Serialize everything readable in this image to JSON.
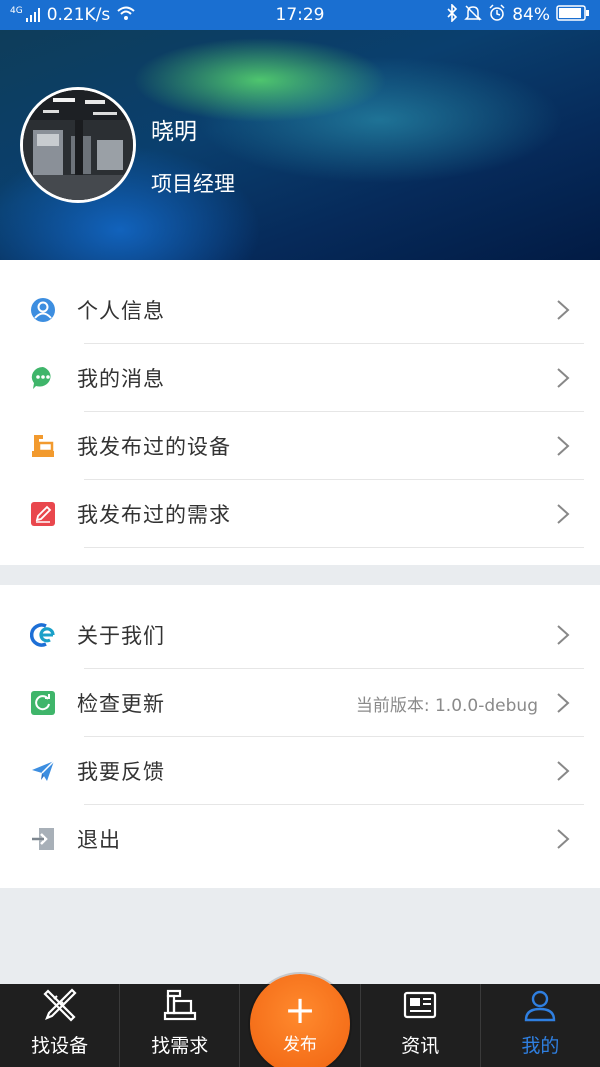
{
  "status_bar": {
    "network": "4G",
    "speed": "0.21K/s",
    "time": "17:29",
    "battery": "84%"
  },
  "profile": {
    "name": "晓明",
    "title": "项目经理"
  },
  "menu_group_1": [
    {
      "label": "个人信息",
      "icon": "person-icon"
    },
    {
      "label": "我的消息",
      "icon": "message-icon"
    },
    {
      "label": "我发布过的设备",
      "icon": "equipment-icon"
    },
    {
      "label": "我发布过的需求",
      "icon": "edit-icon"
    }
  ],
  "menu_group_2": [
    {
      "label": "关于我们",
      "icon": "about-logo-icon"
    },
    {
      "label": "检查更新",
      "icon": "refresh-icon",
      "extra": "当前版本: 1.0.0-debug"
    },
    {
      "label": "我要反馈",
      "icon": "paper-plane-icon"
    },
    {
      "label": "退出",
      "icon": "logout-icon"
    }
  ],
  "tab_bar": {
    "tabs": [
      {
        "label": "找设备",
        "icon": "tools-icon"
      },
      {
        "label": "找需求",
        "icon": "demand-icon"
      },
      {
        "label": "资讯",
        "icon": "news-icon"
      },
      {
        "label": "我的",
        "icon": "user-icon",
        "active": true
      }
    ],
    "publish": {
      "plus": "+",
      "label": "发布"
    }
  },
  "colors": {
    "status_bar": "#1a6fd1",
    "accent": "#2f7fe0",
    "publish": "#f06210",
    "tab_bar": "#1f1f1f"
  }
}
